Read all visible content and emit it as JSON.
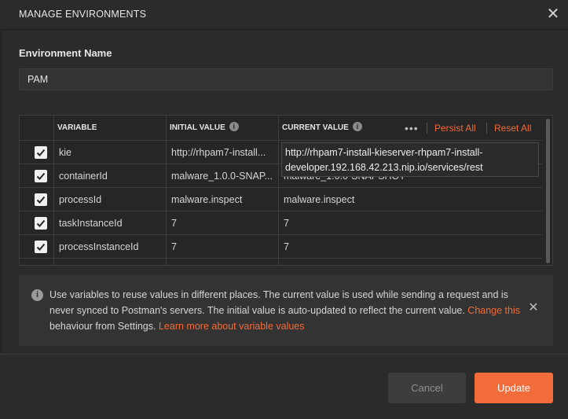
{
  "dialog": {
    "title": "MANAGE ENVIRONMENTS",
    "close_glyph": "✕"
  },
  "environment": {
    "label": "Environment Name",
    "value": "PAM"
  },
  "table": {
    "headers": {
      "variable": "VARIABLE",
      "initial_value": "INITIAL VALUE",
      "current_value": "CURRENT VALUE",
      "info_glyph": "i",
      "more_glyph": "•••",
      "persist_all": "Persist All",
      "reset_all": "Reset All"
    },
    "rows": [
      {
        "checked": true,
        "variable": "kie",
        "initial": "http://rhpam7-install...",
        "current": ""
      },
      {
        "checked": true,
        "variable": "containerId",
        "initial": "malware_1.0.0-SNAP...",
        "current": "malware_1.0.0-SNAPSHOT"
      },
      {
        "checked": true,
        "variable": "processId",
        "initial": "malware.inspect",
        "current": "malware.inspect"
      },
      {
        "checked": true,
        "variable": "taskInstanceId",
        "initial": "7",
        "current": "7"
      },
      {
        "checked": true,
        "variable": "processInstanceId",
        "initial": "7",
        "current": "7"
      }
    ],
    "editing_value": "http://rhpam7-install-kieserver-rhpam7-install-developer.192.168.42.213.nip.io/services/rest"
  },
  "info_banner": {
    "icon_glyph": "i",
    "text_1": "Use variables to reuse values in different places. The current value is used while sending a request and is never synced to Postman's servers. The initial value is auto-updated to reflect the current value. ",
    "link_change": "Change this",
    "text_2": " behaviour from Settings. ",
    "link_learn": "Learn more about variable values",
    "close_glyph": "✕"
  },
  "footer": {
    "cancel_label": "Cancel",
    "update_label": "Update"
  },
  "colors": {
    "accent": "#f26b3a",
    "background": "#2b2b2b"
  }
}
